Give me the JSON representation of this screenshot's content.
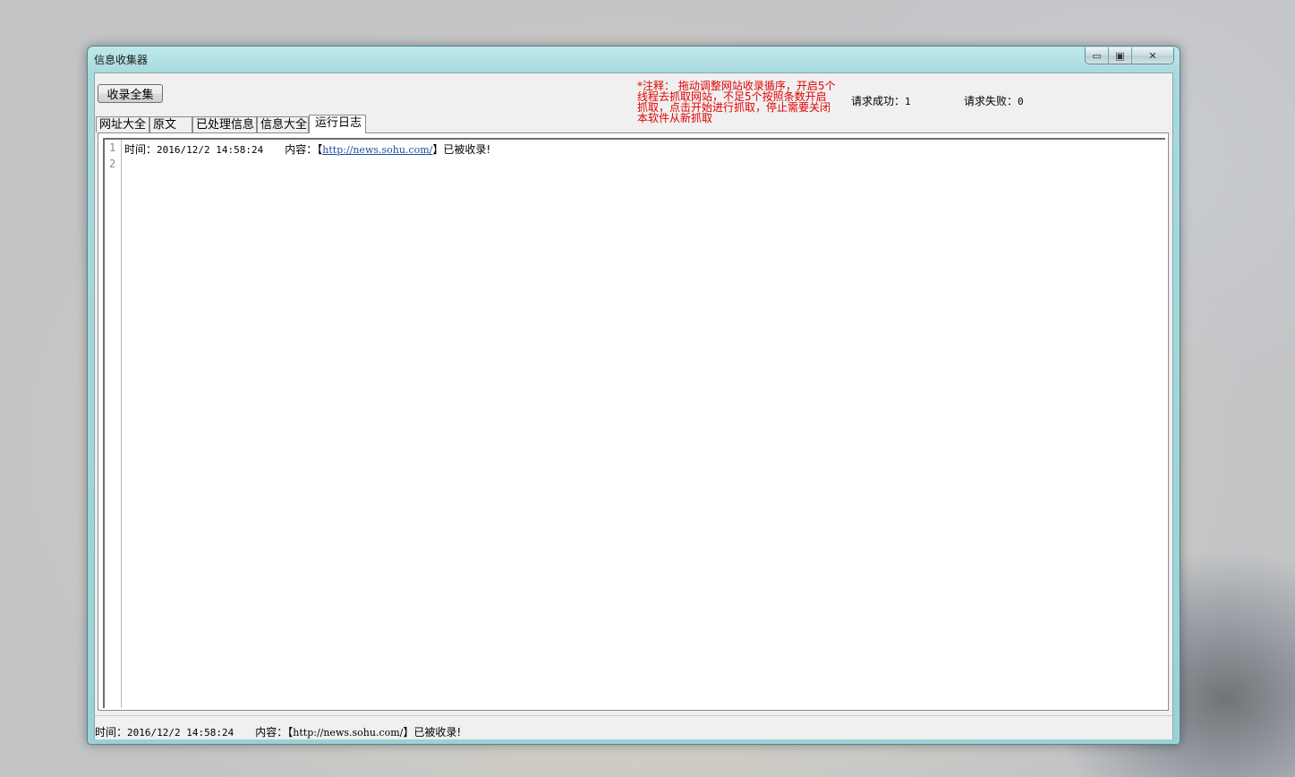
{
  "window": {
    "title": "信息收集器",
    "controls": {
      "minimize": "▭",
      "maximize": "▣",
      "close": "✕"
    }
  },
  "toolbar": {
    "collect_all_label": "收录全集",
    "note": "*注释： 拖动调整网站收录循序，开启5个线程去抓取网站，不足5个按照条数开启抓取，点击开始进行抓取，停止需要关闭本软件从新抓取",
    "request_success_label": "请求成功：",
    "request_success_value": "1",
    "request_fail_label": "请求失败：",
    "request_fail_value": "0"
  },
  "tabs": [
    {
      "label": "网址大全",
      "active": false
    },
    {
      "label": "原文",
      "active": false
    },
    {
      "label": "已处理信息",
      "active": false
    },
    {
      "label": "信息大全",
      "active": false
    },
    {
      "label": "运行日志",
      "active": true
    }
  ],
  "log": {
    "line_numbers": [
      "1",
      "2"
    ],
    "entries": [
      {
        "time_label": "时间：",
        "time_value": "2016/12/2 14:58:24",
        "content_label": "内容：",
        "open_bracket": "【",
        "url": "http://news.sohu.com/",
        "close_suffix": "】已被收录!"
      }
    ]
  },
  "status_bar": {
    "time_label": "时间：",
    "time_value": "2016/12/2 14:58:24",
    "content_label": "内容：",
    "open_bracket": "【",
    "url": "http://news.sohu.com/",
    "close_suffix": "】已被收录!"
  }
}
